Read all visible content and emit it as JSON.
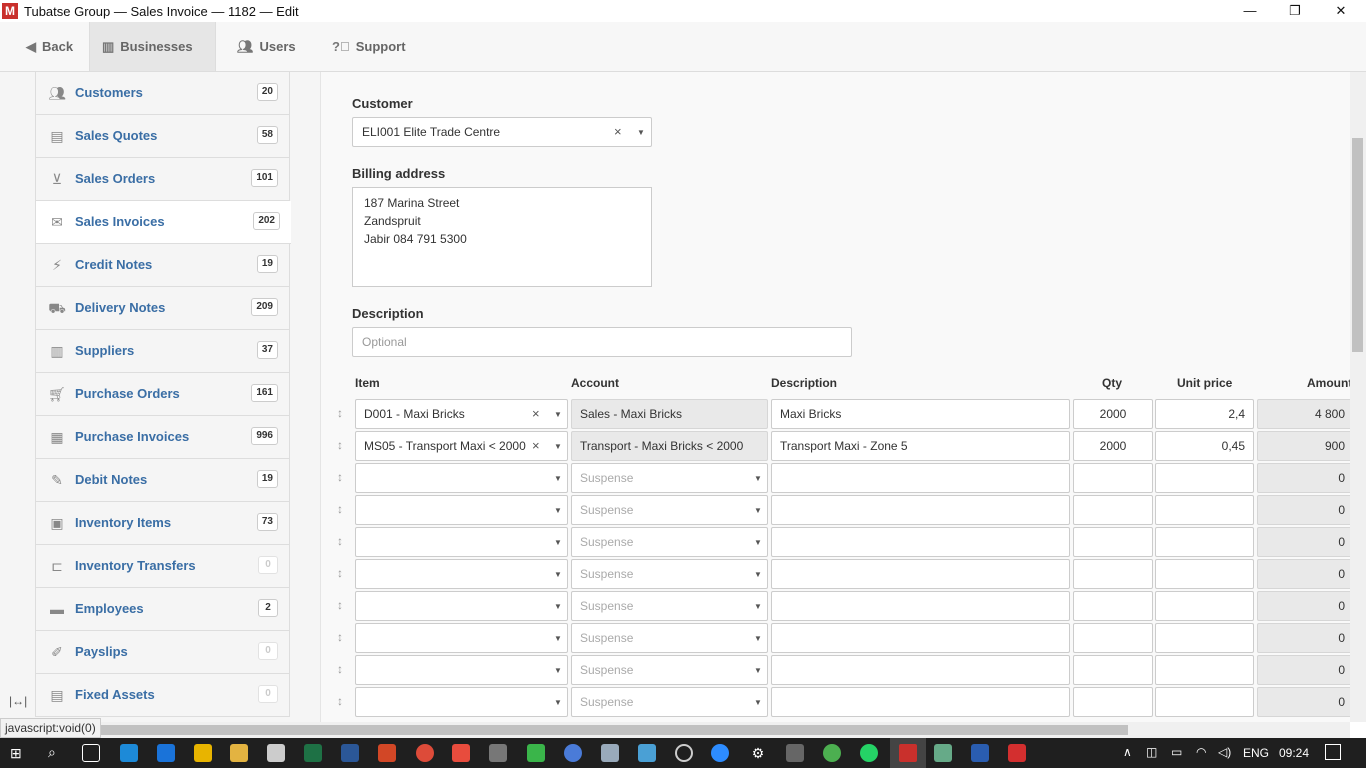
{
  "window": {
    "title": "Tubatse Group — Sales Invoice — 1182 — Edit",
    "logo_letter": "M",
    "min": "—",
    "restore": "❐",
    "close": "✕"
  },
  "nav": {
    "back": "Back",
    "businesses": "Businesses",
    "users": "Users",
    "support": "Support"
  },
  "sidebar": {
    "items": [
      {
        "label": "Customers",
        "count": "20",
        "icon": "customers-icon"
      },
      {
        "label": "Sales Quotes",
        "count": "58",
        "icon": "sales-quotes-icon"
      },
      {
        "label": "Sales Orders",
        "count": "101",
        "icon": "basket-icon"
      },
      {
        "label": "Sales Invoices",
        "count": "202",
        "icon": "envelope-icon"
      },
      {
        "label": "Credit Notes",
        "count": "19",
        "icon": "lightning-icon"
      },
      {
        "label": "Delivery Notes",
        "count": "209",
        "icon": "truck-icon"
      },
      {
        "label": "Suppliers",
        "count": "37",
        "icon": "buildings-icon"
      },
      {
        "label": "Purchase Orders",
        "count": "161",
        "icon": "cart-icon"
      },
      {
        "label": "Purchase Invoices",
        "count": "996",
        "icon": "calendar-icon"
      },
      {
        "label": "Debit Notes",
        "count": "19",
        "icon": "edit-doc-icon"
      },
      {
        "label": "Inventory Items",
        "count": "73",
        "icon": "box-icon"
      },
      {
        "label": "Inventory Transfers",
        "count": "0",
        "icon": "forklift-icon"
      },
      {
        "label": "Employees",
        "count": "2",
        "icon": "id-card-icon"
      },
      {
        "label": "Payslips",
        "count": "0",
        "icon": "payslip-icon"
      },
      {
        "label": "Fixed Assets",
        "count": "0",
        "icon": "assets-icon"
      }
    ]
  },
  "form": {
    "customer_label": "Customer",
    "customer_value": "ELI001 Elite Trade Centre",
    "billing_label": "Billing address",
    "billing_value": "187 Marina Street\n Zandspruit\n Jabir 084 791 5300",
    "description_label": "Description",
    "description_placeholder": "Optional"
  },
  "lines": {
    "headers": {
      "item": "Item",
      "account": "Account",
      "description": "Description",
      "qty": "Qty",
      "unit_price": "Unit price",
      "amount": "Amount"
    },
    "rows": [
      {
        "item": "D001 - Maxi Bricks",
        "account": "Sales - Maxi Bricks",
        "description": "Maxi Bricks",
        "qty": "2000",
        "unit_price": "2,4",
        "amount": "4 800"
      },
      {
        "item": "MS05 - Transport Maxi < 2000",
        "account": "Transport - Maxi Bricks < 2000",
        "description": "Transport Maxi - Zone 5",
        "qty": "2000",
        "unit_price": "0,45",
        "amount": "900"
      },
      {
        "item": "",
        "account": "Suspense",
        "description": "",
        "qty": "",
        "unit_price": "",
        "amount": "0"
      },
      {
        "item": "",
        "account": "Suspense",
        "description": "",
        "qty": "",
        "unit_price": "",
        "amount": "0"
      },
      {
        "item": "",
        "account": "Suspense",
        "description": "",
        "qty": "",
        "unit_price": "",
        "amount": "0"
      },
      {
        "item": "",
        "account": "Suspense",
        "description": "",
        "qty": "",
        "unit_price": "",
        "amount": "0"
      },
      {
        "item": "",
        "account": "Suspense",
        "description": "",
        "qty": "",
        "unit_price": "",
        "amount": "0"
      },
      {
        "item": "",
        "account": "Suspense",
        "description": "",
        "qty": "",
        "unit_price": "",
        "amount": "0"
      },
      {
        "item": "",
        "account": "Suspense",
        "description": "",
        "qty": "",
        "unit_price": "",
        "amount": "0"
      },
      {
        "item": "",
        "account": "Suspense",
        "description": "",
        "qty": "",
        "unit_price": "",
        "amount": "0"
      }
    ]
  },
  "statusbar": {
    "text": "javascript:void(0)"
  },
  "taskbar": {
    "lang": "ENG",
    "time": "09:24"
  },
  "colors": {
    "link": "#3a6ea5",
    "accent_red": "#c9302c"
  }
}
